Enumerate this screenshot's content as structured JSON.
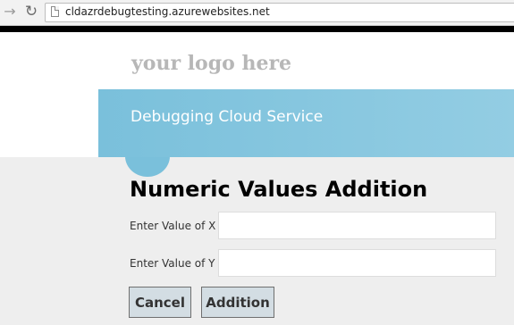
{
  "browser": {
    "url": "cldazrdebugtesting.azurewebsites.net",
    "back_icon": "arrow-left-icon",
    "reload_icon": "reload-icon"
  },
  "site": {
    "logo_text": "your logo here",
    "banner_title": "Debugging Cloud Service"
  },
  "form": {
    "title": "Numeric Values Addition",
    "x_label": "Enter Value of X",
    "x_value": "",
    "y_label": "Enter Value of Y",
    "y_value": "",
    "cancel_label": "Cancel",
    "submit_label": "Addition"
  },
  "colors": {
    "banner": "#7ac0db",
    "page_background": "#eeeeee",
    "button": "#d3dde3"
  }
}
